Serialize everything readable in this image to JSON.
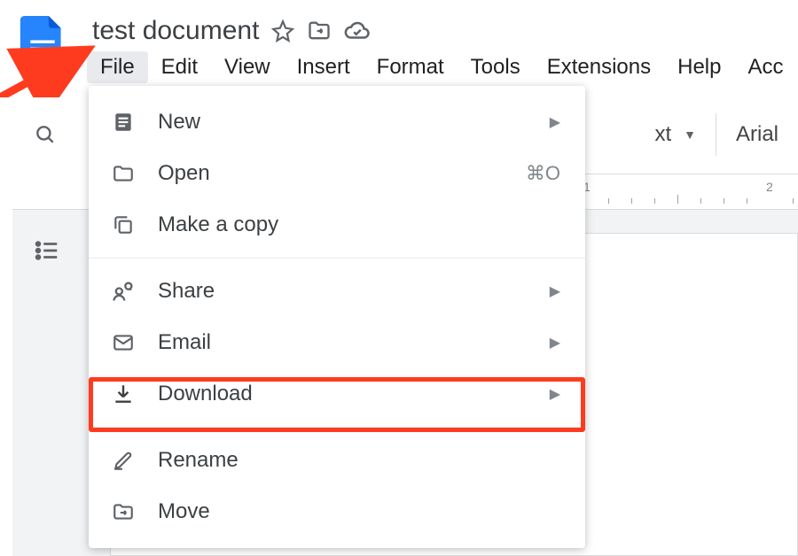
{
  "header": {
    "doc_title": "test document"
  },
  "menubar": {
    "file": "File",
    "edit": "Edit",
    "view": "View",
    "insert": "Insert",
    "format": "Format",
    "tools": "Tools",
    "extensions": "Extensions",
    "help": "Help",
    "accessibility": "Acc"
  },
  "toolbar": {
    "style_partial": "xt",
    "font": "Arial"
  },
  "ruler": {
    "tick1": "1",
    "tick2": "2"
  },
  "file_menu": {
    "new": "New",
    "open": "Open",
    "open_shortcut": "⌘O",
    "make_copy": "Make a copy",
    "share": "Share",
    "email": "Email",
    "download": "Download",
    "rename": "Rename",
    "move": "Move"
  }
}
